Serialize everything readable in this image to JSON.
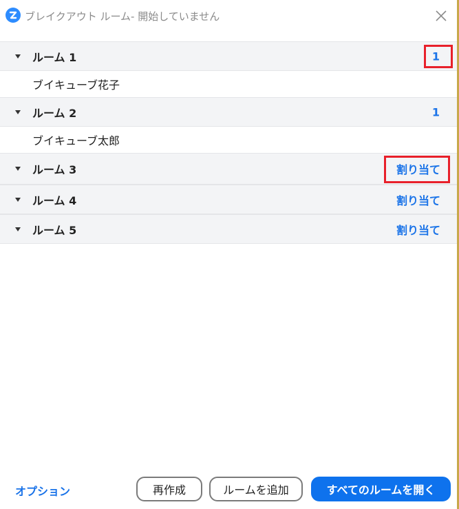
{
  "window": {
    "title": "ブレイクアウト ルーム- 開始していません"
  },
  "icons": {
    "app": "zoom-logo-icon",
    "close": "close-icon",
    "expand": "caret-down-icon"
  },
  "colors": {
    "accent": "#1a73e8",
    "primary_button": "#0e72ed",
    "highlight": "#e8202a",
    "room_header_bg": "#f3f4f6"
  },
  "rooms": [
    {
      "name": "ルーム 1",
      "right": "1",
      "participants": [
        "ブイキューブ花子"
      ]
    },
    {
      "name": "ルーム 2",
      "right": "1",
      "participants": [
        "ブイキューブ太郎"
      ]
    },
    {
      "name": "ルーム 3",
      "right": "割り当て",
      "participants": []
    },
    {
      "name": "ルーム 4",
      "right": "割り当て",
      "participants": []
    },
    {
      "name": "ルーム 5",
      "right": "割り当て",
      "participants": []
    }
  ],
  "footer": {
    "options_label": "オプション",
    "recreate_label": "再作成",
    "add_room_label": "ルームを追加",
    "open_all_label": "すべてのルームを開く"
  }
}
